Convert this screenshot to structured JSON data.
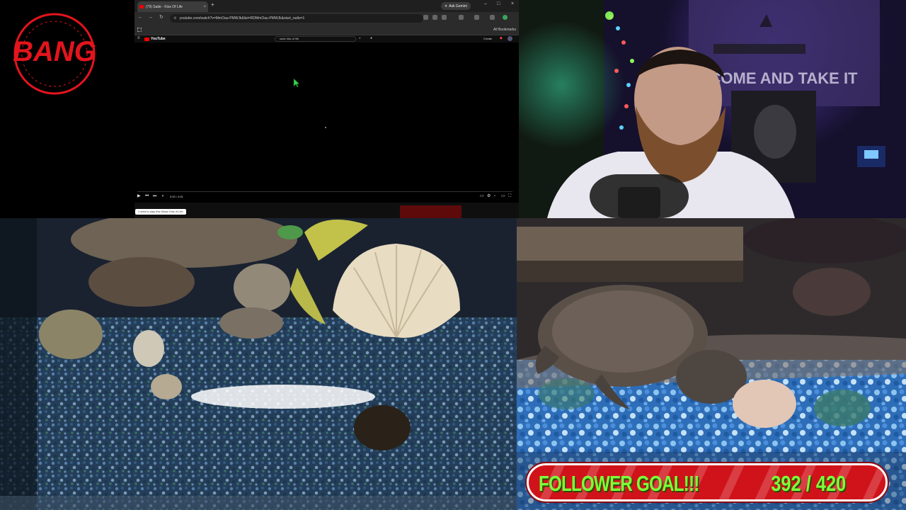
{
  "logo": {
    "text": "BANG",
    "color": "#e3141c"
  },
  "browser": {
    "tab_title": "(79) Sade - Kiss Of Life",
    "ask_gemini": "Ask Gemini",
    "url": "youtube.com/watch?v=MmOau-PMWJk&list=RDMmOau-PMWJk&start_radio=1",
    "all_bookmarks": "All Bookmarks",
    "youtube_logo": "YouTube",
    "search_query": "sade kiss of life",
    "create_label": "Create",
    "player_time": "0:00 / 4:51",
    "progress": 0,
    "pill_text": "I need to play this Music  Kiss of Life"
  },
  "overlay": {
    "follower_goal_label": "FOLLOWER GOAL!!!",
    "follower_count": "392 / 420",
    "goal_color": "#d0131a",
    "text_color": "#7cff3a"
  },
  "icons": {
    "back": "arrow-left-icon",
    "forward": "arrow-right-icon",
    "reload": "reload-icon",
    "play": "play-icon",
    "menu": "hamburger-icon"
  }
}
